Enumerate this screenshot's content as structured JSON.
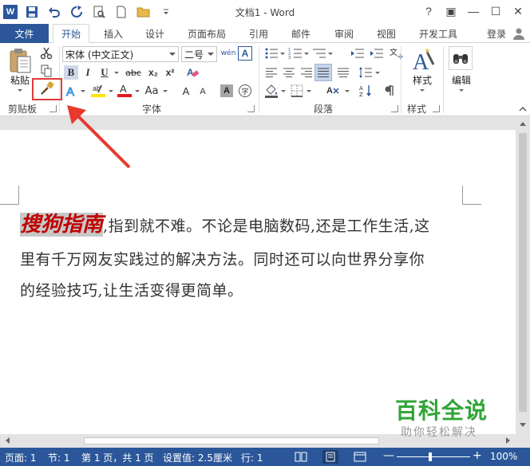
{
  "window": {
    "title": "文档1 - Word",
    "help": "?",
    "restore_ribbon": "▣",
    "minimize": "—",
    "maximize": "☐",
    "close": "✕"
  },
  "tabs": {
    "file": "文件",
    "items": [
      "开始",
      "插入",
      "设计",
      "页面布局",
      "引用",
      "邮件",
      "审阅",
      "视图",
      "开发工具"
    ],
    "login": "登录"
  },
  "ribbon": {
    "clipboard": {
      "paste": "粘贴",
      "group": "剪贴板"
    },
    "font": {
      "name": "宋体 (中文正文)",
      "size": "二号",
      "grow": "A",
      "shrink": "A",
      "case": "Aa",
      "group": "字体",
      "wen": "wén",
      "bold": "B",
      "italic": "I",
      "underline": "U",
      "strike": "abc",
      "sub": "x₂",
      "sup": "x²"
    },
    "paragraph": {
      "group": "段落"
    },
    "styles": {
      "label": "样式",
      "group": "样式"
    },
    "editing": {
      "label": "编辑"
    }
  },
  "document": {
    "selected_text": "搜狗指南",
    "line1_rest": ",指到就不难。不论是电脑数码,还是工作生活,这",
    "line2": "里有千万网友实践过的解决方法。同时还可以向世界分享你",
    "line3": "的经验技巧,让生活变得更简单。"
  },
  "status": {
    "page": "页面: 1",
    "section": "节: 1",
    "pages": "第 1 页，共 1 页",
    "setting": "设置值: 2.5厘米",
    "line": "行: 1",
    "zoom": "100%",
    "zoom_out": "—",
    "zoom_in": "+"
  },
  "watermark": {
    "brand": "百科全说",
    "tagline": "助你轻松解决"
  },
  "colors": {
    "word_blue": "#2b579a",
    "highlight_red": "#e03a3a",
    "selected_text_color": "#c00000",
    "watermark_green": "#2fa536"
  }
}
